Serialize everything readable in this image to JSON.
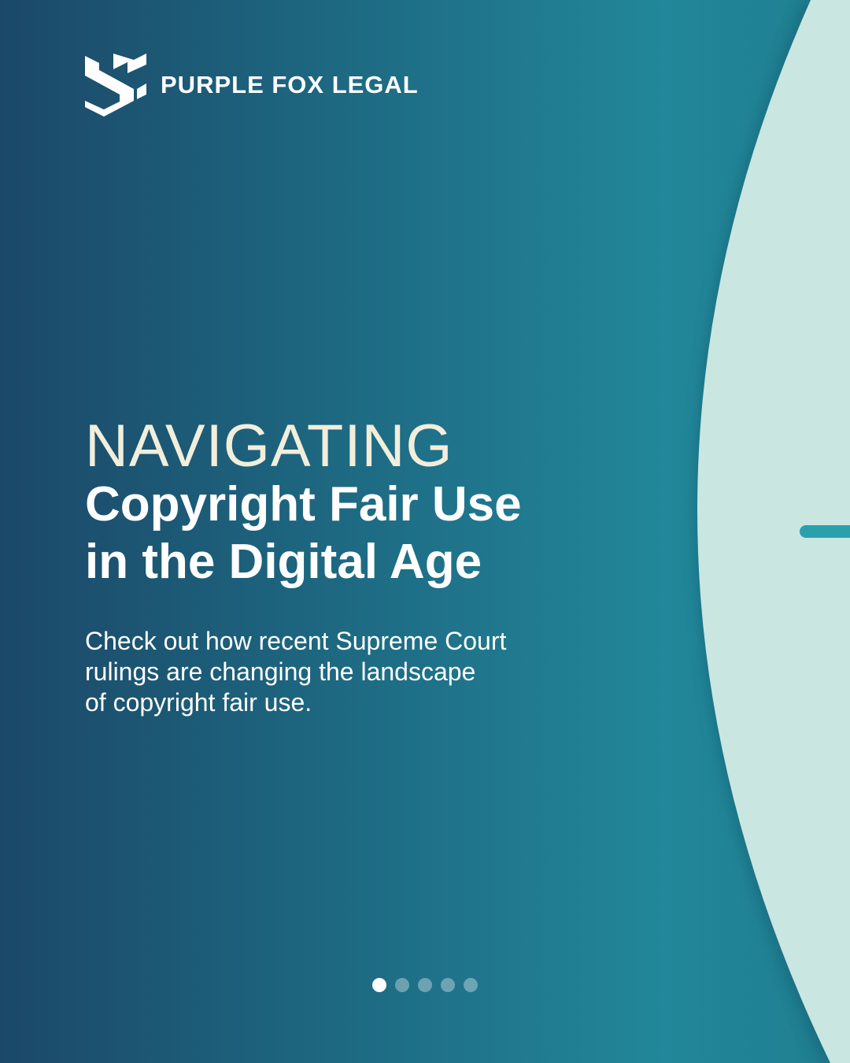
{
  "brand": {
    "name": "PURPLE FOX LEGAL",
    "logo_icon": "purple-fox-legal-logo-mark"
  },
  "headline": {
    "eyebrow": "NAVIGATING",
    "title_line_1": "Copyright Fair Use",
    "title_line_2": "in the Digital Age"
  },
  "subtitle": {
    "line_1": "Check out how recent Supreme Court",
    "line_2": "rulings are changing the landscape",
    "line_3": "of copyright fair use."
  },
  "carousel": {
    "total_slides": 5,
    "current_slide": 1
  },
  "colors": {
    "background_dark": "#1b4868",
    "background_teal": "#22879a",
    "arc_fill": "#c9e6e1",
    "accent_tab": "#2aa0ad",
    "eyebrow_text": "#f2eedc",
    "text": "#ffffff"
  }
}
